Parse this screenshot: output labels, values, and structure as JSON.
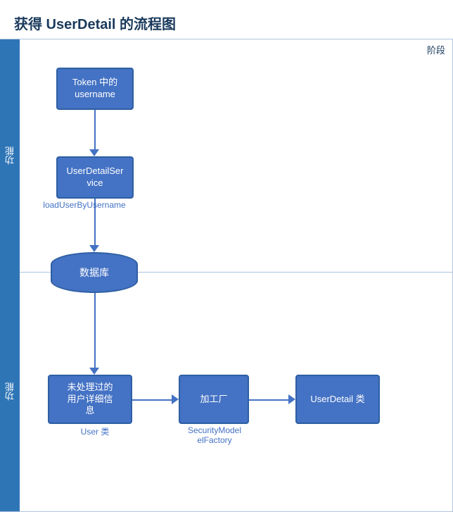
{
  "page": {
    "title": "获得 UserDetail 的流程图",
    "stage_label": "阶段",
    "lane1_label": "功能",
    "lane2_label": "功能",
    "nodes": {
      "token": {
        "label": "Token 中的\nusername"
      },
      "service": {
        "label": "UserDetailSer\nvice"
      },
      "db": {
        "label": "数据库"
      },
      "raw": {
        "label": "未处理过的\n用户详细信\n息"
      },
      "factory": {
        "label": "加工厂"
      },
      "userdetail": {
        "label": "UserDetail 类"
      }
    },
    "labels": {
      "loadUserByUsername": "loadUserByUsername",
      "user_class": "User 类",
      "security_factory": "SecurityModel\nelFactory"
    }
  }
}
